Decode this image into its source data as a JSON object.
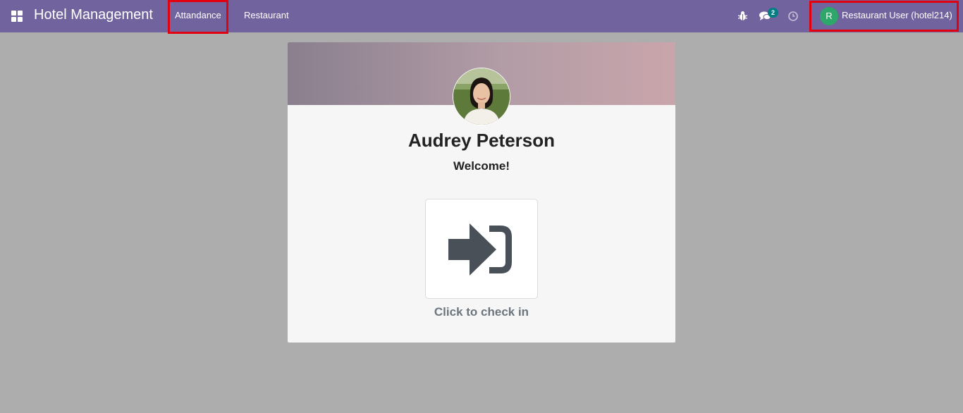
{
  "navbar": {
    "app_title": "Hotel Management",
    "menu": [
      {
        "label": "Attandance"
      },
      {
        "label": "Restaurant"
      }
    ],
    "chat_badge": "2",
    "user": {
      "initial": "R",
      "name": "Restaurant User (hotel214)"
    },
    "icons": [
      "apps-grid-icon",
      "bug-icon",
      "chat-icon",
      "clock-icon"
    ],
    "colors": {
      "bar": "#71639e",
      "highlight": "#e3000f",
      "avatar": "#2ea76a",
      "badge": "#017e84"
    }
  },
  "kiosk": {
    "employee_name": "Audrey Peterson",
    "greeting": "Welcome!",
    "action_label": "Click to check in",
    "action_icon": "sign-in-icon"
  }
}
